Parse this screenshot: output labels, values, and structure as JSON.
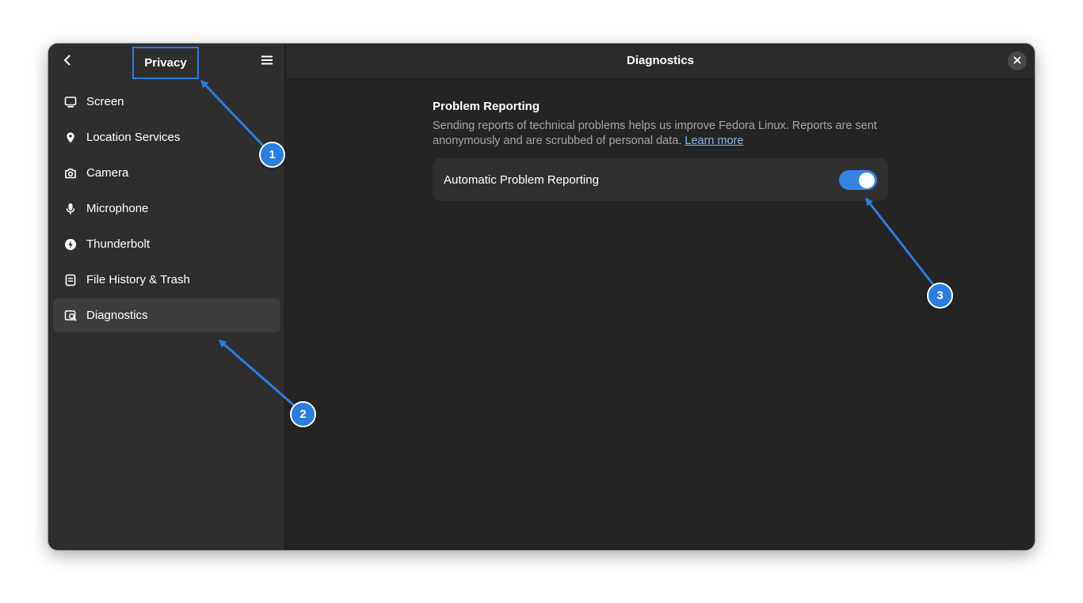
{
  "sidebar": {
    "title": "Privacy",
    "back_icon": "chevron-left-icon",
    "menu_icon": "hamburger-menu-icon",
    "items": [
      {
        "label": "Screen",
        "icon": "monitor-icon",
        "active": false
      },
      {
        "label": "Location Services",
        "icon": "location-pin-icon",
        "active": false
      },
      {
        "label": "Camera",
        "icon": "camera-icon",
        "active": false
      },
      {
        "label": "Microphone",
        "icon": "microphone-icon",
        "active": false
      },
      {
        "label": "Thunderbolt",
        "icon": "thunderbolt-icon",
        "active": false
      },
      {
        "label": "File History & Trash",
        "icon": "file-history-icon",
        "active": false
      },
      {
        "label": "Diagnostics",
        "icon": "diagnostics-icon",
        "active": true
      }
    ]
  },
  "main": {
    "title": "Diagnostics",
    "close_icon": "close-icon",
    "section": {
      "title": "Problem Reporting",
      "description": "Sending reports of technical problems helps us improve Fedora Linux. Reports are sent anonymously and are scrubbed of personal data. ",
      "link_label": "Learn more"
    },
    "setting": {
      "label": "Automatic Problem Reporting",
      "enabled": true
    }
  },
  "annotations": [
    {
      "number": "1"
    },
    {
      "number": "2"
    },
    {
      "number": "3"
    }
  ],
  "colors": {
    "accent": "#2a7de1",
    "switch_on": "#3584e4",
    "window_bg": "#242424",
    "sidebar_bg": "#2e2e2e"
  }
}
